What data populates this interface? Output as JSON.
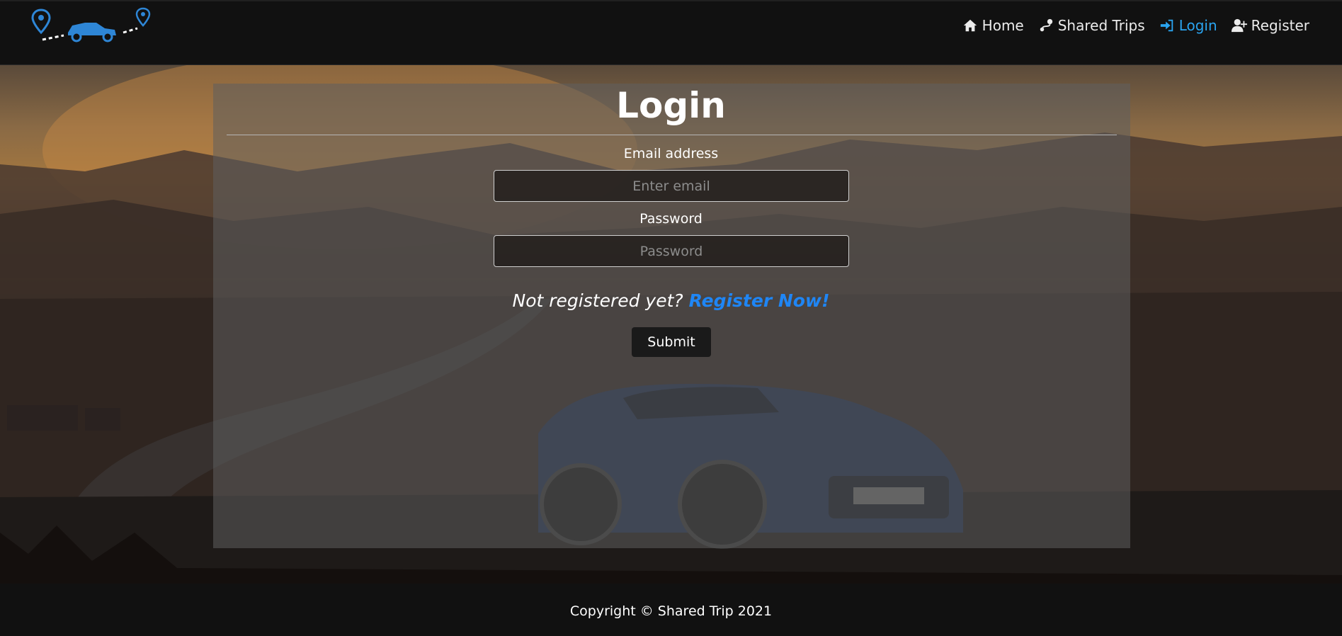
{
  "nav": {
    "items": [
      {
        "label": "Home",
        "icon": "home-icon"
      },
      {
        "label": "Shared Trips",
        "icon": "route-icon"
      },
      {
        "label": "Login",
        "icon": "sign-in-icon",
        "active": true
      },
      {
        "label": "Register",
        "icon": "user-plus-icon"
      }
    ]
  },
  "colors": {
    "accent": "#2aa4f0",
    "link": "#1f86f5",
    "navbar": "#111111",
    "logo": "#2e86d6"
  },
  "form": {
    "title": "Login",
    "email_label": "Email address",
    "email_placeholder": "Enter email",
    "password_label": "Password",
    "password_placeholder": "Password",
    "register_prompt": "Not registered yet?",
    "register_link": "Register Now!",
    "submit_label": "Submit"
  },
  "footer": {
    "text": "Copyright © Shared Trip 2021"
  }
}
